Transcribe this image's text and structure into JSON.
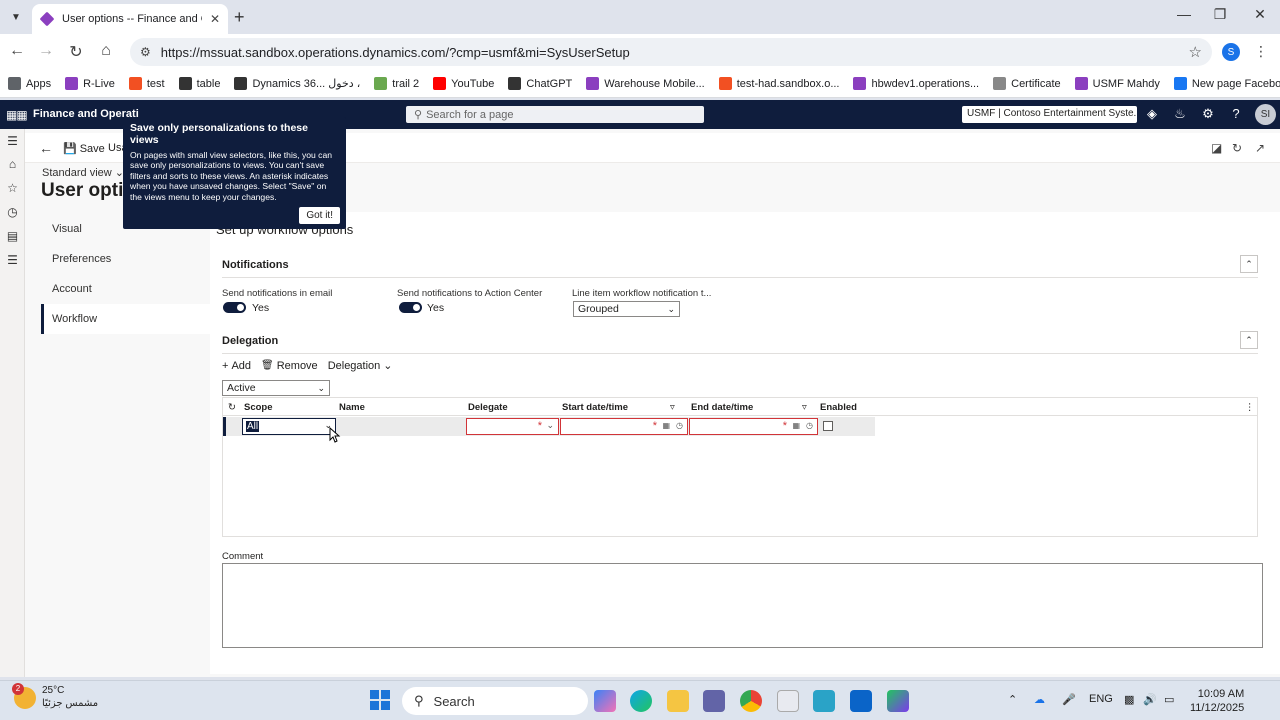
{
  "browser": {
    "tab_title": "User options -- Finance and Op...",
    "url": "https://mssuat.sandbox.operations.dynamics.com/?cmp=usmf&mi=SysUserSetup",
    "profile_initial": "S",
    "bookmarks": [
      {
        "label": "Apps",
        "color": "#5f6368"
      },
      {
        "label": "R-Live",
        "color": "#8b3fbf"
      },
      {
        "label": "test",
        "color": "#f25022"
      },
      {
        "label": "table",
        "color": "#333333"
      },
      {
        "label": "Dynamics 36... دخول ،",
        "color": "#333333"
      },
      {
        "label": "trail 2",
        "color": "#6aa84f"
      },
      {
        "label": "YouTube",
        "color": "#ff0000"
      },
      {
        "label": "ChatGPT",
        "color": "#333333"
      },
      {
        "label": "Warehouse Mobile...",
        "color": "#8b3fbf"
      },
      {
        "label": "test-had.sandbox.o...",
        "color": "#f25022"
      },
      {
        "label": "hbwdev1.operations...",
        "color": "#8b3fbf"
      },
      {
        "label": "Certificate",
        "color": "#888888"
      },
      {
        "label": "USMF Mahdy",
        "color": "#8b3fbf"
      },
      {
        "label": "New page Facebook",
        "color": "#1877f2"
      }
    ]
  },
  "d365": {
    "app_name": "Finance and Operati",
    "search_placeholder": "Search for a page",
    "company": "USMF | Contoso Entertainment Syste...",
    "user_initials": "SI"
  },
  "action_pane": {
    "save_label": "Save",
    "usage_label": "Usa"
  },
  "view_selector": "Standard view",
  "page_title": "User optio",
  "vtabs": [
    "Visual",
    "Preferences",
    "Account",
    "Workflow"
  ],
  "section_title": "Set up workflow options",
  "notifications": {
    "header": "Notifications",
    "email_label": "Send notifications in email",
    "email_value": "Yes",
    "action_center_label": "Send notifications to Action Center",
    "action_center_value": "Yes",
    "line_item_label": "Line item workflow notification t...",
    "line_item_value": "Grouped"
  },
  "delegation": {
    "header": "Delegation",
    "add_label": "Add",
    "remove_label": "Remove",
    "delegation_menu": "Delegation",
    "filter_value": "Active",
    "columns": [
      "Scope",
      "Name",
      "Delegate",
      "Start date/time",
      "End date/time",
      "Enabled"
    ],
    "row": {
      "scope": "All"
    }
  },
  "comment_label": "Comment",
  "callout": {
    "title": "Save only personalizations to these views",
    "body": "On pages with small view selectors, like this, you can save only personalizations to views. You can't save filters and sorts to these views. An asterisk indicates when you have unsaved changes. Select \"Save\" on the views menu to keep your changes.",
    "button": "Got it!"
  },
  "taskbar": {
    "weather_temp": "25°C",
    "weather_desc": "مشمس جزئيًا",
    "weather_badge": "2",
    "search_label": "Search",
    "language": "ENG",
    "time": "10:09 AM",
    "date": "11/12/2025"
  }
}
